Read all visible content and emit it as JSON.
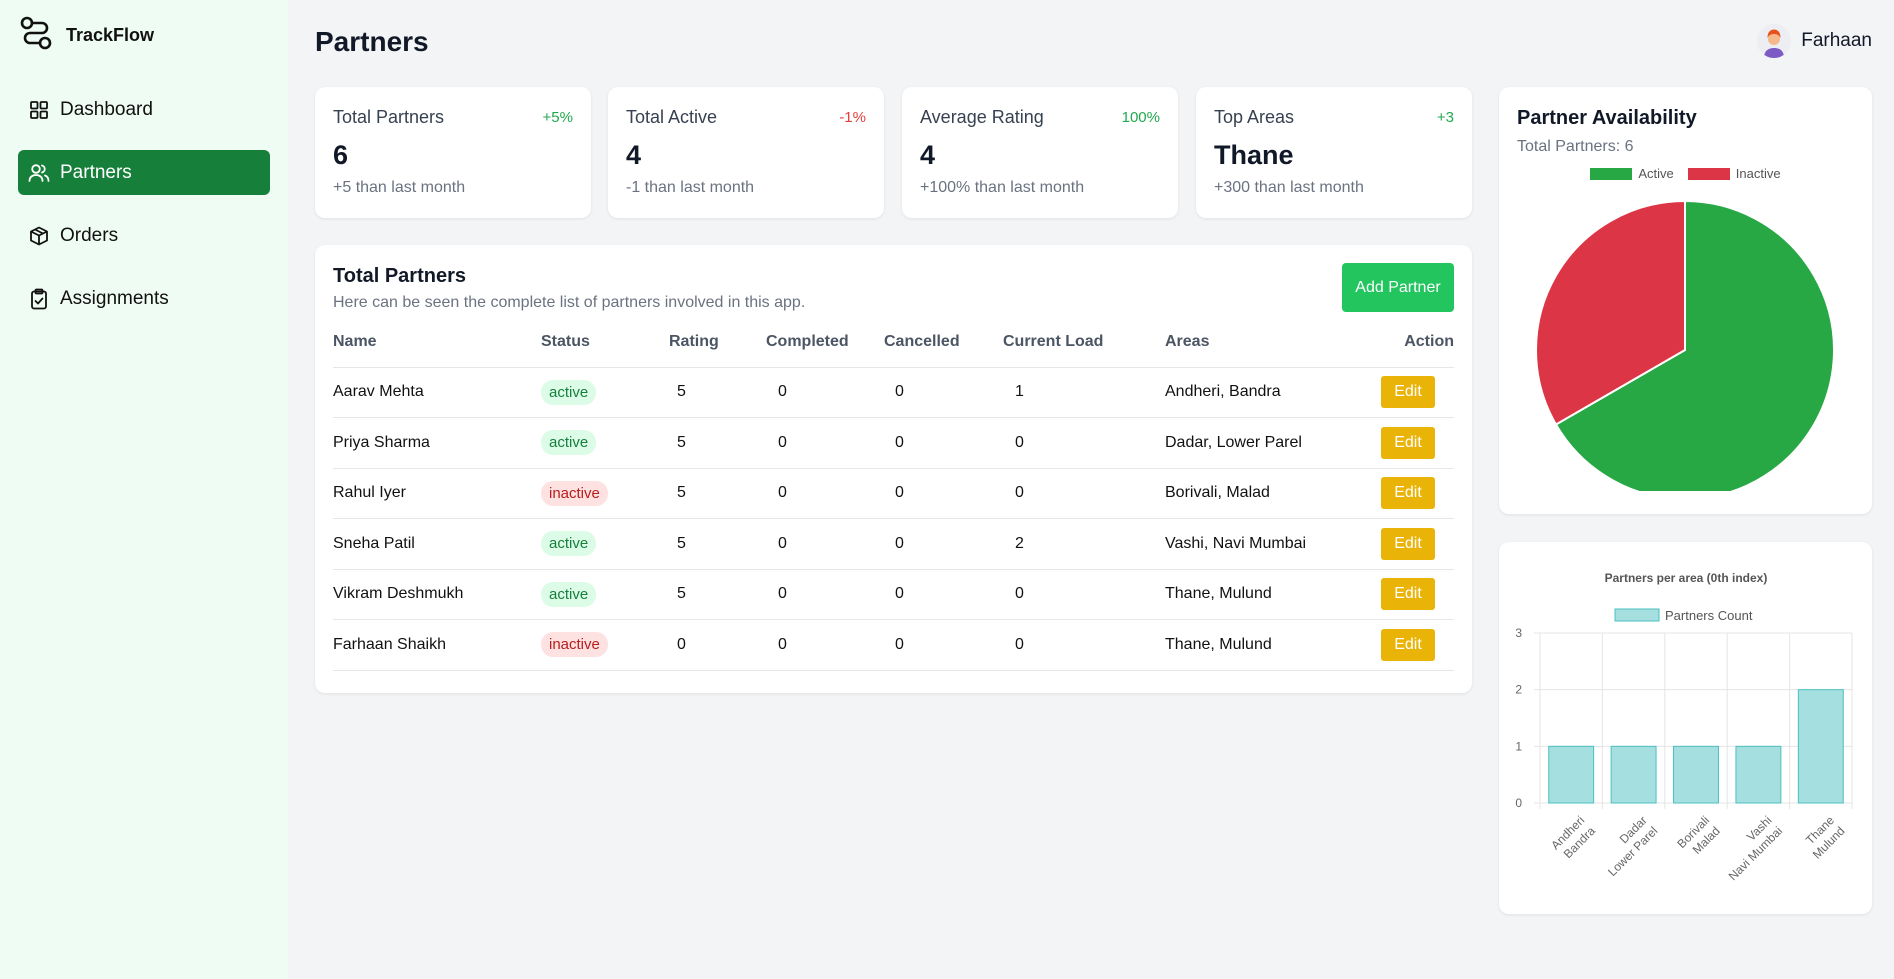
{
  "app": {
    "name": "TrackFlow"
  },
  "sidebar": {
    "items": [
      {
        "label": "Dashboard",
        "icon": "dashboard-grid-icon",
        "active": false
      },
      {
        "label": "Partners",
        "icon": "users-icon",
        "active": true
      },
      {
        "label": "Orders",
        "icon": "package-icon",
        "active": false
      },
      {
        "label": "Assignments",
        "icon": "clipboard-check-icon",
        "active": false
      }
    ]
  },
  "header": {
    "title": "Partners",
    "user_name": "Farhaan"
  },
  "stats": [
    {
      "label": "Total Partners",
      "change": "+5%",
      "value": "6",
      "sub": "+5 than last month"
    },
    {
      "label": "Total Active",
      "change": "-1%",
      "value": "4",
      "sub": "-1 than last month"
    },
    {
      "label": "Average Rating",
      "change": "100%",
      "value": "4",
      "sub": "+100% than last month"
    },
    {
      "label": "Top Areas",
      "change": "+3",
      "value": "Thane",
      "sub": "+300 than last month"
    }
  ],
  "partners_table": {
    "title": "Total Partners",
    "subtitle": "Here can be seen the complete list of partners involved in this app.",
    "add_button": "Add Partner",
    "columns": [
      "Name",
      "Status",
      "Rating",
      "Completed",
      "Cancelled",
      "Current Load",
      "Areas",
      "Action"
    ],
    "rows": [
      {
        "name": "Aarav Mehta",
        "status": "active",
        "rating": "5",
        "completed": "0",
        "cancelled": "0",
        "load": "1",
        "areas": "Andheri, Bandra",
        "action": "Edit"
      },
      {
        "name": "Priya Sharma",
        "status": "active",
        "rating": "5",
        "completed": "0",
        "cancelled": "0",
        "load": "0",
        "areas": "Dadar, Lower Parel",
        "action": "Edit"
      },
      {
        "name": "Rahul Iyer",
        "status": "inactive",
        "rating": "5",
        "completed": "0",
        "cancelled": "0",
        "load": "0",
        "areas": "Borivali, Malad",
        "action": "Edit"
      },
      {
        "name": "Sneha Patil",
        "status": "active",
        "rating": "5",
        "completed": "0",
        "cancelled": "0",
        "load": "2",
        "areas": "Vashi, Navi Mumbai",
        "action": "Edit"
      },
      {
        "name": "Vikram Deshmukh",
        "status": "active",
        "rating": "5",
        "completed": "0",
        "cancelled": "0",
        "load": "0",
        "areas": "Thane, Mulund",
        "action": "Edit"
      },
      {
        "name": "Farhaan Shaikh",
        "status": "inactive",
        "rating": "0",
        "completed": "0",
        "cancelled": "0",
        "load": "0",
        "areas": "Thane, Mulund",
        "action": "Edit"
      }
    ]
  },
  "availability": {
    "title": "Partner Availability",
    "subtitle": "Total Partners: 6"
  },
  "colors": {
    "brand_green": "#16803b",
    "active_green": "#28a745",
    "inactive_red": "#dc3545",
    "bar_fill": "#a5dfdf",
    "bar_stroke": "#4bc0c0",
    "edit_yellow": "#eab308"
  },
  "chart_data": [
    {
      "type": "pie",
      "legend": [
        "Active",
        "Inactive"
      ],
      "legend_position": "top",
      "values": [
        4,
        2
      ],
      "colors": [
        "#28a745",
        "#dc3545"
      ]
    },
    {
      "type": "bar",
      "title": "Partners per area (0th index)",
      "legend": [
        "Partners Count"
      ],
      "legend_position": "top",
      "categories": [
        [
          "Andheri",
          "Bandra"
        ],
        [
          "Dadar",
          "Lower Parel"
        ],
        [
          "Borivali",
          "Malad"
        ],
        [
          "Vashi",
          "Navi Mumbai"
        ],
        [
          "Thane",
          "Mulund"
        ]
      ],
      "values": [
        1,
        1,
        1,
        1,
        2
      ],
      "ylim": [
        0,
        3
      ],
      "yticks": [
        "0",
        "1",
        "2",
        "3"
      ],
      "grid": true
    }
  ]
}
